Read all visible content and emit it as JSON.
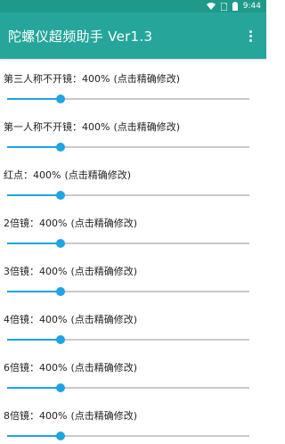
{
  "status_bar": {
    "time": "9:44",
    "icons": [
      "wifi-icon",
      "sim-icon",
      "battery-icon"
    ]
  },
  "app_bar": {
    "title": "陀螺仪超频助手 Ver1.3",
    "menu_icon": "overflow-menu-icon"
  },
  "settings": [
    {
      "name": "第三人称不开镜",
      "value": "400%",
      "hint": "(点击精确修改)",
      "slider_fraction": 0.22
    },
    {
      "name": "第一人称不开镜",
      "value": "400%",
      "hint": "(点击精确修改)",
      "slider_fraction": 0.22
    },
    {
      "name": "红点",
      "value": "400%",
      "hint": "(点击精确修改)",
      "slider_fraction": 0.22
    },
    {
      "name": "2倍镜",
      "value": "400%",
      "hint": "(点击精确修改)",
      "slider_fraction": 0.22
    },
    {
      "name": "3倍镜",
      "value": "400%",
      "hint": "(点击精确修改)",
      "slider_fraction": 0.22
    },
    {
      "name": "4倍镜",
      "value": "400%",
      "hint": "(点击精确修改)",
      "slider_fraction": 0.22
    },
    {
      "name": "6倍镜",
      "value": "400%",
      "hint": "(点击精确修改)",
      "slider_fraction": 0.22
    },
    {
      "name": "8倍镜",
      "value": "400%",
      "hint": "(点击精确修改)",
      "slider_fraction": 0.22
    }
  ],
  "colors": {
    "app_bar": "#26a69a",
    "status_bar": "#1f9a8a",
    "slider_accent": "#1ea3e3",
    "slider_track": "#c9c9c9"
  }
}
